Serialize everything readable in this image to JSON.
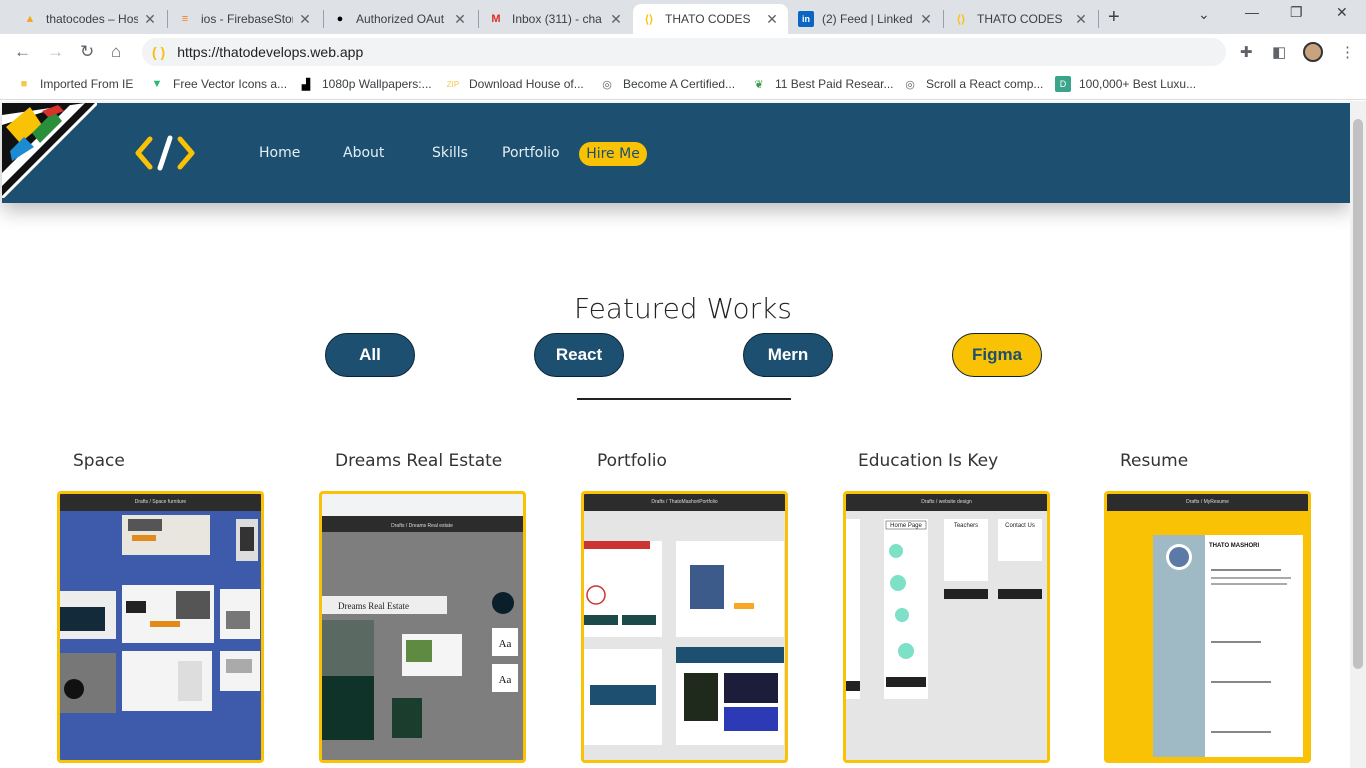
{
  "browser": {
    "tabs": [
      {
        "title": "thatocodes – Hos",
        "icon": "firebase-icon"
      },
      {
        "title": "ios - FirebaseStor",
        "icon": "stackoverflow-icon"
      },
      {
        "title": "Authorized OAut",
        "icon": "github-icon"
      },
      {
        "title": "Inbox (311) - cha",
        "icon": "gmail-icon"
      },
      {
        "title": "THATO CODES",
        "icon": "site-code-icon",
        "active": true
      },
      {
        "title": "(2) Feed | Linked",
        "icon": "linkedin-icon"
      },
      {
        "title": "THATO CODES",
        "icon": "site-code-icon"
      }
    ],
    "url": "https://thatodevelops.web.app",
    "bookmarks": [
      {
        "label": "Imported From IE",
        "icon": "folder-icon"
      },
      {
        "label": "Free Vector Icons a...",
        "icon": "vector-icon"
      },
      {
        "label": "1080p Wallpapers:...",
        "icon": "wallpaper-icon"
      },
      {
        "label": "Download House of...",
        "icon": "house-icon"
      },
      {
        "label": "Become A Certified...",
        "icon": "globe-icon"
      },
      {
        "label": "11 Best Paid Resear...",
        "icon": "leaf-icon"
      },
      {
        "label": "Scroll a React comp...",
        "icon": "globe-icon"
      },
      {
        "label": "100,000+ Best Luxu...",
        "icon": "d-icon"
      }
    ]
  },
  "site": {
    "logo": "</>",
    "nav": [
      "Home",
      "About",
      "Skills",
      "Portfolio"
    ],
    "hire": "Hire Me",
    "section_title": "Featured Works",
    "filters": [
      "All",
      "React",
      "Mern",
      "Figma"
    ],
    "selected_filter": "Figma",
    "projects": [
      {
        "title": "Space",
        "bar": "Drafts / Space furniture"
      },
      {
        "title": "Dreams Real Estate",
        "bar": "Drafts / Dreams Real estate"
      },
      {
        "title": "Portfolio",
        "bar": "Drafts / ThatoMashoriPortfolio"
      },
      {
        "title": "Education Is Key",
        "bar": "Drafts / website design"
      },
      {
        "title": "Resume",
        "bar": "Drafts / MyResume"
      }
    ]
  },
  "colors": {
    "brand": "#1d5070",
    "accent": "#f9c205"
  }
}
